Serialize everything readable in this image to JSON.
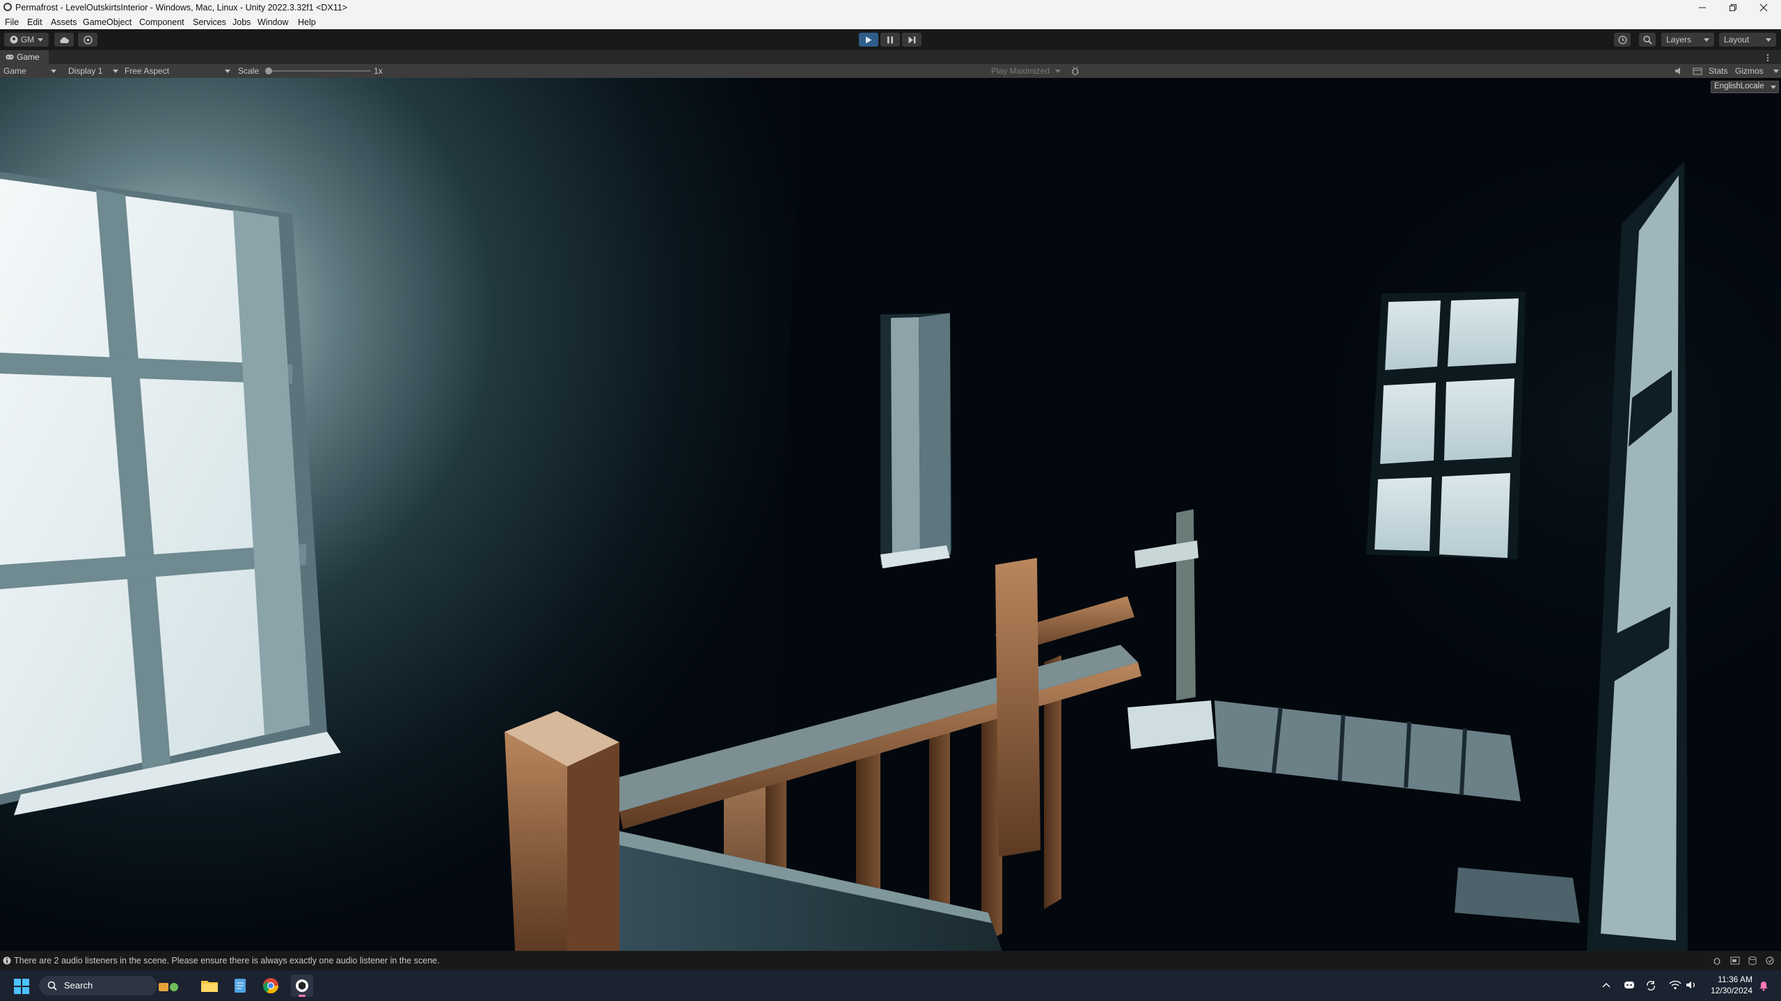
{
  "window": {
    "title": "Permafrost - LevelOutskirtsInterior - Windows, Mac, Linux - Unity 2022.3.32f1 <DX11>",
    "minimize_icon": "minimize-icon",
    "restore_icon": "restore-icon",
    "close_icon": "close-icon"
  },
  "menu": [
    "File",
    "Edit",
    "Assets",
    "GameObject",
    "Component",
    "Services",
    "Jobs",
    "Window",
    "Help"
  ],
  "toolbar": {
    "account_label": "GM",
    "layers_label": "Layers",
    "layout_label": "Layout",
    "play_state": "playing",
    "accent": "#2f5d8a"
  },
  "game_view": {
    "tab_label": "Game",
    "mode_label": "Game",
    "display_label": "Display 1",
    "aspect_label": "Free Aspect",
    "scale_label": "Scale",
    "scale_value": "1x",
    "play_maximized_label": "Play Maximized",
    "stats_label": "Stats",
    "gizmos_label": "Gizmos",
    "locale_label": "EnglishLocale"
  },
  "status": {
    "message": "There are 2 audio listeners in the scene. Please ensure there is always exactly one audio listener in the scene."
  },
  "taskbar": {
    "search_label": "Search",
    "time": "11:36 AM",
    "date": "12/30/2024"
  }
}
